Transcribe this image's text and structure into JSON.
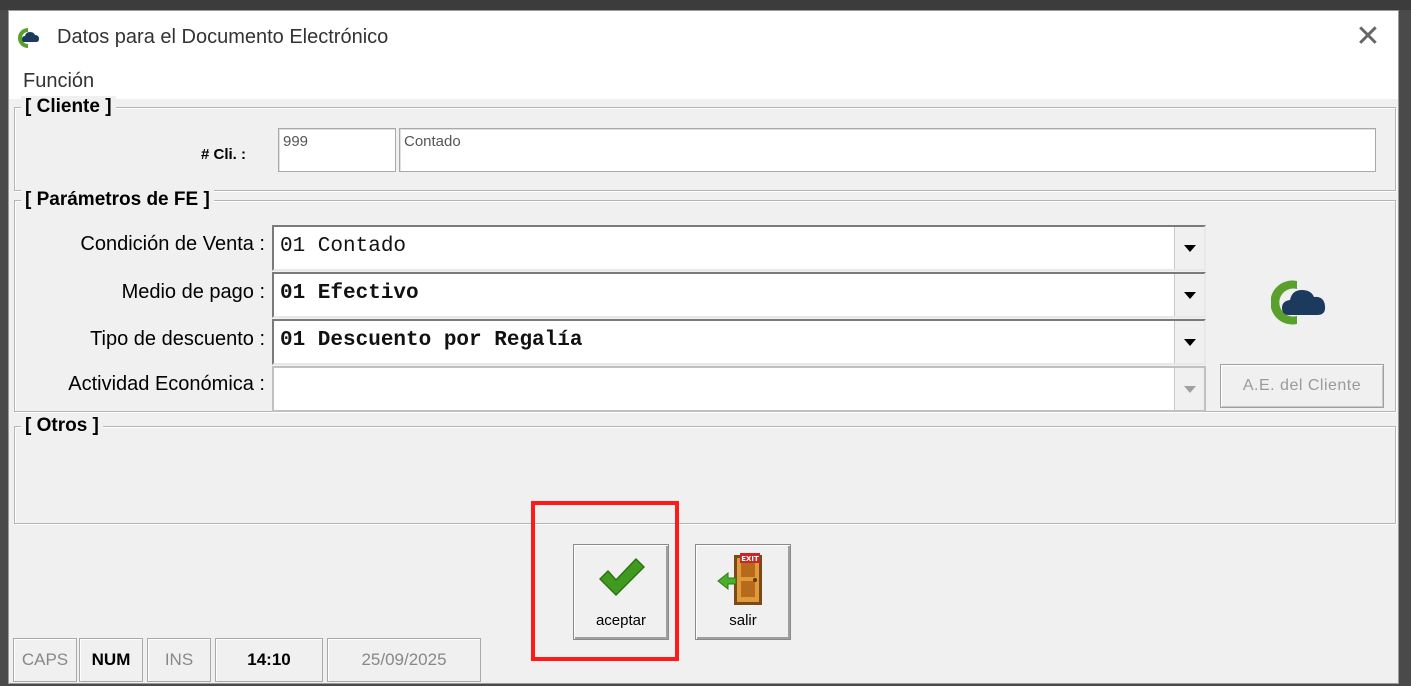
{
  "window": {
    "title": "Datos para el Documento Electrónico",
    "close_glyph": "✕"
  },
  "menu": {
    "items": [
      "Función"
    ]
  },
  "cliente": {
    "group_label": "[ Cliente ]",
    "cli_label": "# Cli. :",
    "cli_number": "999",
    "cli_name": "Contado"
  },
  "parametros": {
    "group_label": "[ Parámetros de FE ]",
    "condicion_label": "Condición de Venta :",
    "condicion_value": "01 Contado",
    "medio_label": "Medio de pago :",
    "medio_value": "01 Efectivo",
    "descuento_label": "Tipo de descuento :",
    "descuento_value": "01 Descuento por Regalía",
    "actividad_label": "Actividad Económica :",
    "actividad_value": "",
    "ae_button": "A.E. del Cliente"
  },
  "otros": {
    "group_label": "[ Otros ]"
  },
  "actions": {
    "accept_label": "aceptar",
    "exit_label": "salir",
    "exit_sign_text": "EXIT"
  },
  "status": {
    "caps": "CAPS",
    "num": "NUM",
    "ins": "INS",
    "time": "14:10",
    "date": "25/09/2025"
  },
  "colors": {
    "highlight": "#ff1a1a",
    "logo_green": "#5aa02c",
    "logo_navy": "#1c3a5e",
    "check_green": "#3f9a1f"
  },
  "icons": {
    "app": "cloud-logo-icon",
    "close": "close-icon",
    "accept": "checkmark-icon",
    "exit": "exit-door-icon"
  }
}
